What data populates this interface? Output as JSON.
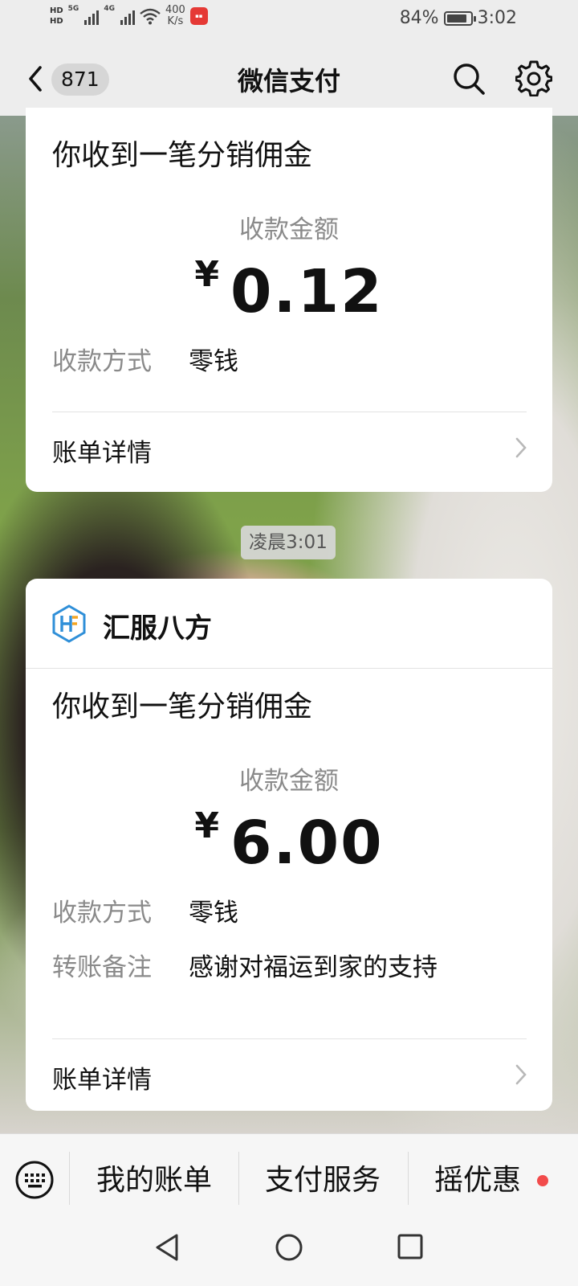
{
  "status_bar": {
    "hd1": "HD",
    "hd2": "HD",
    "net1": "5G",
    "net2": "4G",
    "speed_value": "400",
    "speed_unit": "K/s",
    "battery": "84%",
    "battery_level": 0.84,
    "time": "3:02"
  },
  "nav": {
    "back_badge": "871",
    "title": "微信支付"
  },
  "messages": [
    {
      "title": "你收到一笔分销佣金",
      "amount_label": "收款金额",
      "currency": "¥",
      "amount": "0.12",
      "method_key": "收款方式",
      "method_value": "零钱",
      "detail": "账单详情"
    },
    {
      "merchant": "汇服八方",
      "title": "你收到一笔分销佣金",
      "amount_label": "收款金额",
      "currency": "¥",
      "amount": "6.00",
      "method_key": "收款方式",
      "method_value": "零钱",
      "note_key": "转账备注",
      "note_value": "感谢对福运到家的支持",
      "detail": "账单详情"
    }
  ],
  "timestamp": "凌晨3:01",
  "bottom_menu": {
    "items": [
      "我的账单",
      "支付服务",
      "摇优惠"
    ]
  },
  "colors": {
    "background": "#ededed",
    "card": "#ffffff",
    "muted_text": "#8a8a8a",
    "merchant_blue": "#2f8fd8",
    "merchant_orange": "#f5a623",
    "notify_red": "#f24b4b"
  },
  "icons": [
    "back-icon",
    "search-icon",
    "gear-icon",
    "merchant-logo-icon",
    "chevron-right-icon",
    "keyboard-icon",
    "sys-back-icon",
    "sys-home-icon",
    "sys-recent-icon"
  ]
}
